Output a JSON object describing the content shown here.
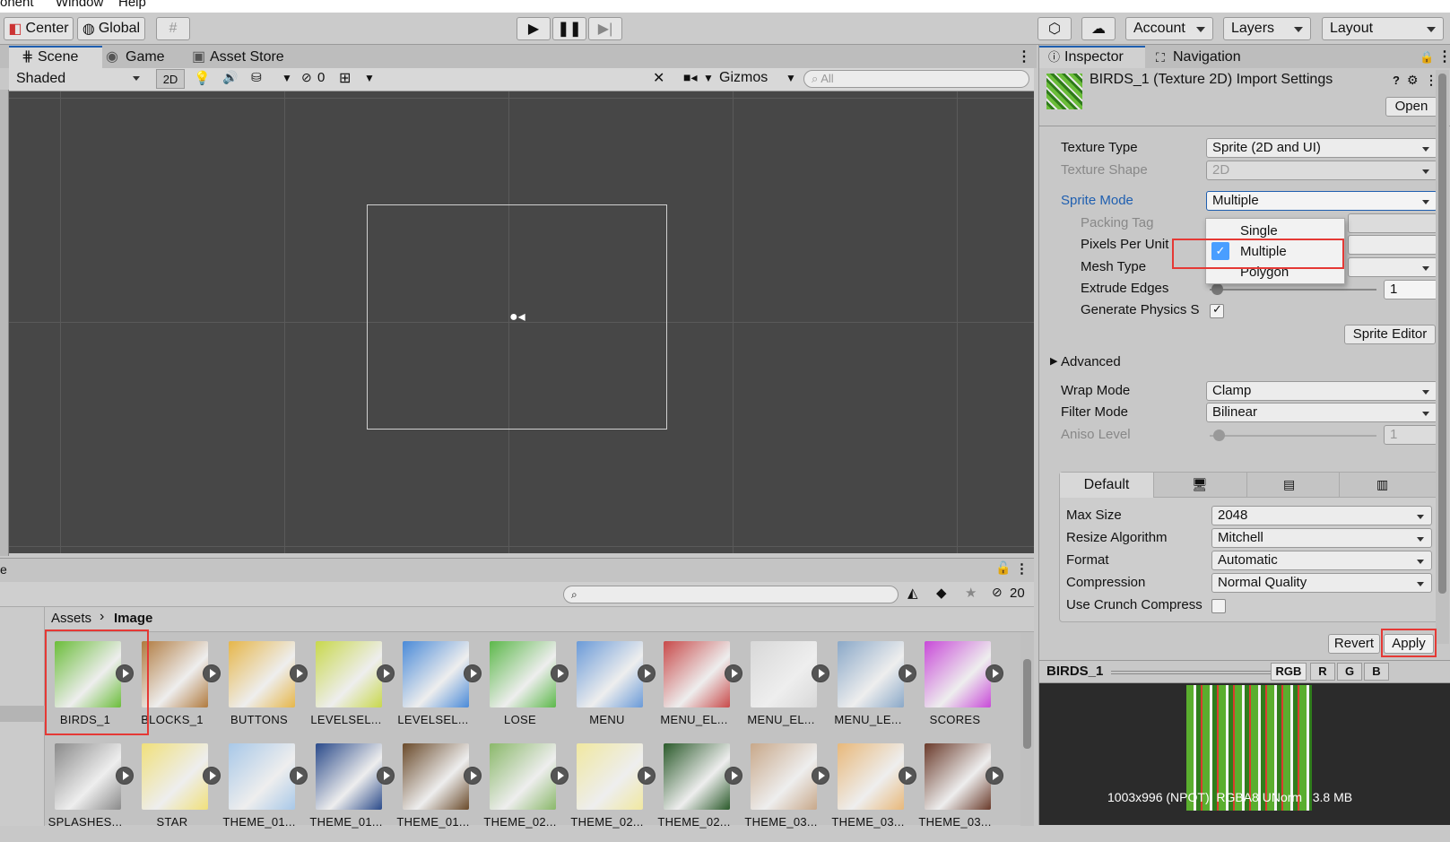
{
  "menubar": {
    "component": "onent",
    "window": "Window",
    "help": "Help"
  },
  "toolbar": {
    "center": "Center",
    "global": "Global",
    "account": "Account",
    "layers": "Layers",
    "layout": "Layout"
  },
  "tabs": {
    "scene": "Scene",
    "game": "Game",
    "asset_store": "Asset Store",
    "inspector": "Inspector",
    "navigation": "Navigation"
  },
  "scenebar": {
    "shading": "Shaded",
    "mode_2d": "2D",
    "hidden_count": "0",
    "gizmos": "Gizmos",
    "search_placeholder": "All"
  },
  "inspector": {
    "title": "BIRDS_1 (Texture 2D) Import Settings",
    "open": "Open",
    "texture_type_label": "Texture Type",
    "texture_type": "Sprite (2D and UI)",
    "texture_shape_label": "Texture Shape",
    "texture_shape": "2D",
    "sprite_mode_label": "Sprite Mode",
    "sprite_mode": "Multiple",
    "packing_tag_label": "Packing Tag",
    "ppu_label": "Pixels Per Unit",
    "mesh_type_label": "Mesh Type",
    "extrude_label": "Extrude Edges",
    "extrude_value": "1",
    "gen_physics_label": "Generate Physics S",
    "sprite_editor": "Sprite Editor",
    "advanced": "Advanced",
    "wrap_label": "Wrap Mode",
    "wrap": "Clamp",
    "filter_label": "Filter Mode",
    "filter": "Bilinear",
    "aniso_label": "Aniso Level",
    "aniso": "1",
    "platform_default": "Default",
    "max_size_label": "Max Size",
    "max_size": "2048",
    "resize_label": "Resize Algorithm",
    "resize": "Mitchell",
    "format_label": "Format",
    "format": "Automatic",
    "compression_label": "Compression",
    "compression": "Normal Quality",
    "crunch_label": "Use Crunch Compress",
    "revert": "Revert",
    "apply": "Apply"
  },
  "dropdown": {
    "options": [
      "Single",
      "Multiple",
      "Polygon"
    ],
    "selected": "Multiple"
  },
  "preview": {
    "name": "BIRDS_1",
    "channels": [
      "RGB",
      "R",
      "G",
      "B"
    ],
    "info": "1003x996 (NPOT)  RGBA8 UNorm   3.8 MB"
  },
  "project": {
    "breadcrumb_root": "Assets",
    "breadcrumb_current": "Image",
    "hidden_count": "20",
    "left_label": "e",
    "row1": [
      "BIRDS_1",
      "BLOCKS_1",
      "BUTTONS",
      "LEVELSEL...",
      "LEVELSEL...",
      "LOSE",
      "MENU",
      "MENU_EL...",
      "MENU_EL...",
      "MENU_LE...",
      "SCORES"
    ],
    "row2": [
      "SPLASHES...",
      "STAR",
      "THEME_01...",
      "THEME_01...",
      "THEME_01...",
      "THEME_02...",
      "THEME_02...",
      "THEME_02...",
      "THEME_03...",
      "THEME_03...",
      "THEME_03..."
    ]
  },
  "colors": {
    "highlight": "#e53935",
    "accent": "#1f5fb0",
    "check_bg": "#4a9eff"
  }
}
